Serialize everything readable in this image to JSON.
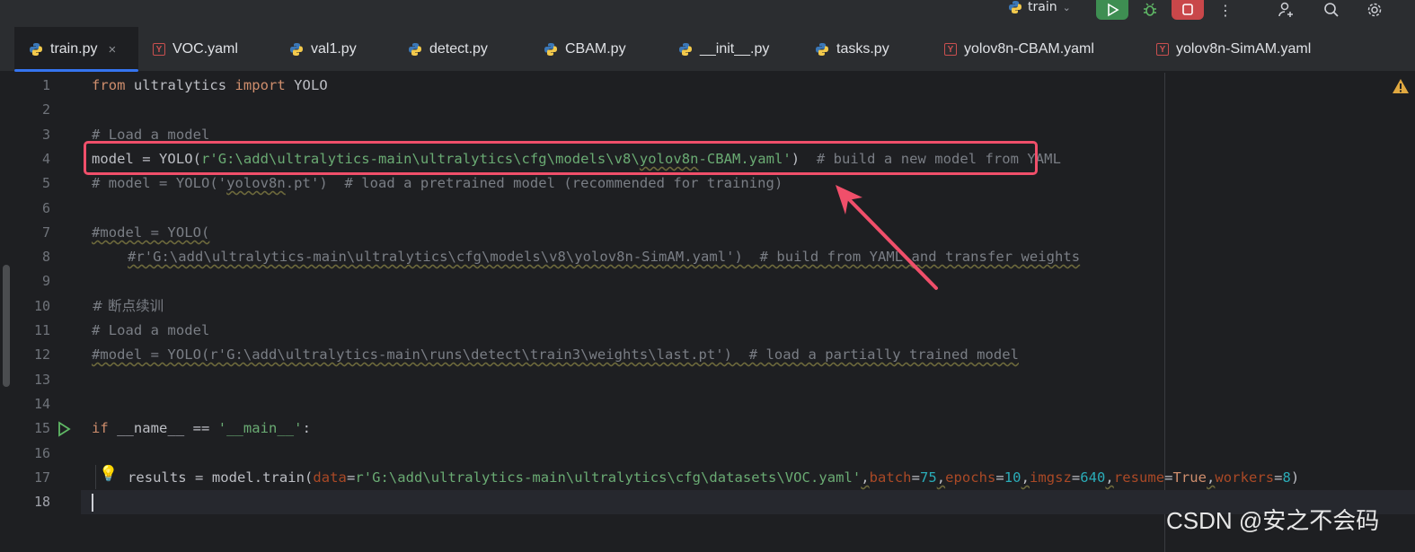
{
  "toolbar": {
    "run_config": "train"
  },
  "tabs": [
    {
      "label": "train.py",
      "icon": "python-icon",
      "active": true
    },
    {
      "label": "VOC.yaml",
      "icon": "yaml-icon"
    },
    {
      "label": "val1.py",
      "icon": "python-icon"
    },
    {
      "label": "detect.py",
      "icon": "python-icon"
    },
    {
      "label": "CBAM.py",
      "icon": "python-icon"
    },
    {
      "label": "__init__.py",
      "icon": "python-icon"
    },
    {
      "label": "tasks.py",
      "icon": "python-icon"
    },
    {
      "label": "yolov8n-CBAM.yaml",
      "icon": "yaml-icon"
    },
    {
      "label": "yolov8n-SimAM.yaml",
      "icon": "yaml-icon"
    }
  ],
  "tab_close": "×",
  "yaml_glyph": "Y",
  "editor": {
    "line_numbers": [
      "1",
      "2",
      "3",
      "4",
      "5",
      "6",
      "7",
      "8",
      "9",
      "10",
      "11",
      "12",
      "13",
      "14",
      "15",
      "16",
      "17",
      "18"
    ],
    "current_line": 18,
    "code": {
      "l1_kw1": "from",
      "l1_mod": " ultralytics ",
      "l1_kw2": "import",
      "l1_name": " YOLO",
      "l3": "# Load a model",
      "l4_a": "model = YOLO(",
      "l4_str_a": "r'G:\\add\\ultralytics-main\\ultralytics\\cfg\\models\\v8\\",
      "l4_str_b": "yolov8n",
      "l4_str_c": "-CBAM.yaml'",
      "l4_b": ")  ",
      "l4_cmt": "# build a new model from YAML",
      "l5_a": "# model = YOLO('",
      "l5_b": "yolov8n",
      "l5_c": ".pt')  # load a pretrained model (recommended for training)",
      "l7": "#model = YOLO(",
      "l8": "#r'G:\\add\\ultralytics-main\\ultralytics\\cfg\\models\\v8\\yolov8n-SimAM.yaml')  # build from YAML and transfer weights",
      "l10": "# 断点续训",
      "l11": "# Load a model",
      "l12": "#model = YOLO(r'G:\\add\\ultralytics-main\\runs\\detect\\train3\\weights\\last.pt')  # load a partially trained model",
      "l15_kw": "if",
      "l15_a": " __name__ == ",
      "l15_str": "'__main__'",
      "l15_b": ":",
      "l17_a": "results = model.train(",
      "l17_p1": "data",
      "l17_eq": "=",
      "l17_s1": "r'G:\\add\\ultralytics-main\\ultralytics\\cfg\\datasets\\VOC.yaml'",
      "l17_c1": ",",
      "l17_p2": "batch",
      "l17_n2": "75",
      "l17_p3": "epochs",
      "l17_n3": "10",
      "l17_p4": "imgsz",
      "l17_n4": "640",
      "l17_p5": "resume",
      "l17_v5": "True",
      "l17_p6": "workers",
      "l17_n6": "8",
      "l17_end": ")"
    }
  },
  "watermark": "CSDN @安之不会码",
  "colors": {
    "highlight_box": "#f04f6a",
    "accent": "#3574f0"
  }
}
